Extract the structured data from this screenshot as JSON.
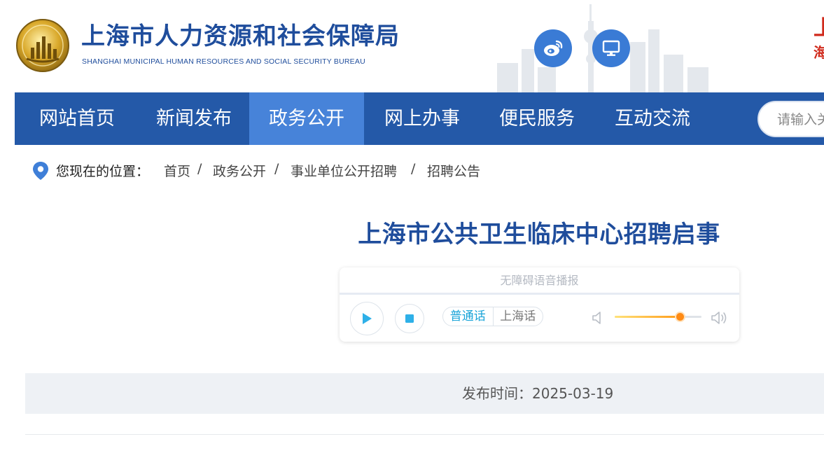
{
  "header": {
    "title": "上海市人力资源和社会保障局",
    "subtitle": "SHANGHAI MUNICIPAL HUMAN RESOURCES AND SOCIAL SECURITY BUREAU",
    "corner_text_1": "上",
    "corner_text_2": "海"
  },
  "nav": {
    "items": [
      {
        "label": "网站首页"
      },
      {
        "label": "新闻发布"
      },
      {
        "label": "政务公开"
      },
      {
        "label": "网上办事"
      },
      {
        "label": "便民服务"
      },
      {
        "label": "互动交流"
      }
    ],
    "active_index": 2,
    "search_placeholder": "请输入关键字"
  },
  "breadcrumb": {
    "prefix": "您现在的位置：",
    "items": [
      "首页",
      "政务公开",
      "事业单位公开招聘",
      "招聘公告"
    ],
    "separator": "/"
  },
  "article": {
    "title": "上海市公共卫生临床中心招聘启事"
  },
  "player": {
    "caption": "无障碍语音播报",
    "dialects": [
      "普通话",
      "上海话"
    ],
    "active_dialect": 0,
    "volume": 0.75
  },
  "meta": {
    "publish_label": "发布时间：",
    "publish_date": "2025-03-19"
  },
  "colors": {
    "brand_blue": "#1f4d9c",
    "nav_bg": "#2459a8",
    "nav_active": "#4783d9",
    "icon_button": "#3a7bd5",
    "accent_cyan": "#1aa4d8",
    "volume_orange": "#ff8a14"
  },
  "icons": [
    "emblem-logo",
    "weibo-icon",
    "computer-icon",
    "location-pin-icon",
    "play-icon",
    "stop-icon",
    "volume-low-icon",
    "volume-high-icon"
  ]
}
